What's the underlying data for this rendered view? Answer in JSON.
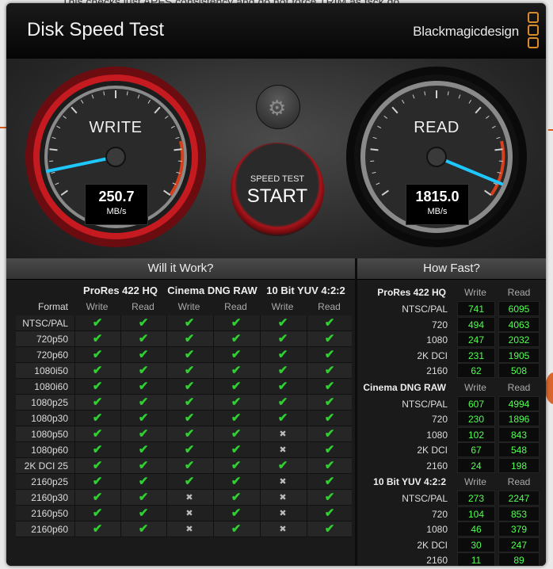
{
  "background": {
    "text": "This checks just APFS consistency and do not force TRIM as fsck do"
  },
  "window": {
    "title": "Disk Speed Test",
    "brand": "Blackmagicdesign"
  },
  "gauges": {
    "write": {
      "label": "WRITE",
      "value": "250.7",
      "unit": "MB/s",
      "needle_fraction": 0.14
    },
    "read": {
      "label": "READ",
      "value": "1815.0",
      "unit": "MB/s",
      "needle_fraction": 1.0
    }
  },
  "start_button": {
    "top": "SPEED TEST",
    "main": "START"
  },
  "settings_icon": "gear-icon",
  "colors": {
    "accent_red": "#a8141a",
    "needle": "#1ec8ff",
    "tick_green": "#30d030",
    "number_green": "#52ff52",
    "brand_orange": "#d98a2a"
  },
  "will_it_work": {
    "title": "Will it Work?",
    "groups": [
      "ProRes 422 HQ",
      "Cinema DNG RAW",
      "10 Bit YUV 4:2:2"
    ],
    "format_label": "Format",
    "write_label": "Write",
    "read_label": "Read",
    "rows": [
      {
        "format": "NTSC/PAL",
        "checks": [
          1,
          1,
          1,
          1,
          1,
          1
        ]
      },
      {
        "format": "720p50",
        "checks": [
          1,
          1,
          1,
          1,
          1,
          1
        ]
      },
      {
        "format": "720p60",
        "checks": [
          1,
          1,
          1,
          1,
          1,
          1
        ]
      },
      {
        "format": "1080i50",
        "checks": [
          1,
          1,
          1,
          1,
          1,
          1
        ]
      },
      {
        "format": "1080i60",
        "checks": [
          1,
          1,
          1,
          1,
          1,
          1
        ]
      },
      {
        "format": "1080p25",
        "checks": [
          1,
          1,
          1,
          1,
          1,
          1
        ]
      },
      {
        "format": "1080p30",
        "checks": [
          1,
          1,
          1,
          1,
          1,
          1
        ]
      },
      {
        "format": "1080p50",
        "checks": [
          1,
          1,
          1,
          1,
          0,
          1
        ]
      },
      {
        "format": "1080p60",
        "checks": [
          1,
          1,
          1,
          1,
          0,
          1
        ]
      },
      {
        "format": "2K DCI 25",
        "checks": [
          1,
          1,
          1,
          1,
          1,
          1
        ]
      },
      {
        "format": "2160p25",
        "checks": [
          1,
          1,
          1,
          1,
          0,
          1
        ]
      },
      {
        "format": "2160p30",
        "checks": [
          1,
          1,
          0,
          1,
          0,
          1
        ]
      },
      {
        "format": "2160p50",
        "checks": [
          1,
          1,
          0,
          1,
          0,
          1
        ]
      },
      {
        "format": "2160p60",
        "checks": [
          1,
          1,
          0,
          1,
          0,
          1
        ]
      }
    ]
  },
  "how_fast": {
    "title": "How Fast?",
    "write_label": "Write",
    "read_label": "Read",
    "groups": [
      {
        "name": "ProRes 422 HQ",
        "rows": [
          {
            "label": "NTSC/PAL",
            "write": "741",
            "read": "6095"
          },
          {
            "label": "720",
            "write": "494",
            "read": "4063"
          },
          {
            "label": "1080",
            "write": "247",
            "read": "2032"
          },
          {
            "label": "2K DCI",
            "write": "231",
            "read": "1905"
          },
          {
            "label": "2160",
            "write": "62",
            "read": "508"
          }
        ]
      },
      {
        "name": "Cinema DNG RAW",
        "rows": [
          {
            "label": "NTSC/PAL",
            "write": "607",
            "read": "4994"
          },
          {
            "label": "720",
            "write": "230",
            "read": "1896"
          },
          {
            "label": "1080",
            "write": "102",
            "read": "843"
          },
          {
            "label": "2K DCI",
            "write": "67",
            "read": "548"
          },
          {
            "label": "2160",
            "write": "24",
            "read": "198"
          }
        ]
      },
      {
        "name": "10 Bit YUV 4:2:2",
        "rows": [
          {
            "label": "NTSC/PAL",
            "write": "273",
            "read": "2247"
          },
          {
            "label": "720",
            "write": "104",
            "read": "853"
          },
          {
            "label": "1080",
            "write": "46",
            "read": "379"
          },
          {
            "label": "2K DCI",
            "write": "30",
            "read": "247"
          },
          {
            "label": "2160",
            "write": "11",
            "read": "89"
          }
        ]
      }
    ]
  }
}
